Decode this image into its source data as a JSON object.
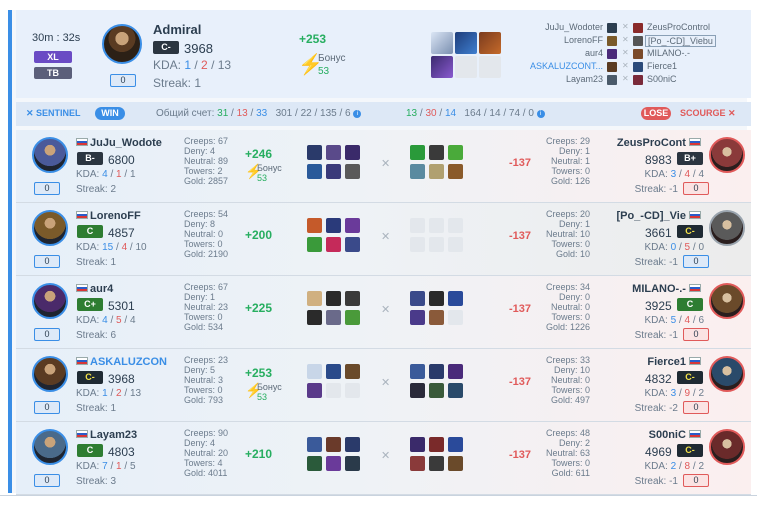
{
  "header": {
    "timer": "30m : 32s",
    "badge_xl": "XL",
    "badge_tb": "TB",
    "player_name": "Admiral",
    "rank": "C-",
    "rating": "3968",
    "kda_label": "KDA: ",
    "kills": "1",
    "deaths": "2",
    "assists": "13",
    "streak": "Streak: 1",
    "count": "0",
    "delta": "+253",
    "bonus_label": "Бонус",
    "bonus_value": "53"
  },
  "matchups": [
    {
      "left": "JuJu_Wodoter",
      "right": "ZeusProControl",
      "left_link": false,
      "boxed": false
    },
    {
      "left": "LorenoFF",
      "right": "[Po_-CD]_Viebu",
      "left_link": false,
      "boxed": true
    },
    {
      "left": "aur4",
      "right": "MILANO-.-",
      "left_link": false,
      "boxed": false
    },
    {
      "left": "ASKALUZCONT...",
      "right": "Fierce1",
      "left_link": true,
      "boxed": false
    },
    {
      "left": "Layam23",
      "right": "S00niC",
      "left_link": false,
      "boxed": false
    }
  ],
  "teambar": {
    "sentinel": "SENTINEL",
    "win": "WIN",
    "score_prefix": "Общий счет: ",
    "left_kills": "31",
    "left_deaths": "13",
    "left_assists": "33",
    "left_creeps": "301 / 22 / 135 / 6",
    "right_kills": "13",
    "right_deaths": "30",
    "right_assists": "14",
    "right_creeps": "164 / 14 / 74 / 0",
    "lose": "LOSE",
    "scourge": "SCOURGE",
    "info": "i"
  },
  "rows": [
    {
      "left": {
        "name": "JuJu_Wodote",
        "rank": "B-",
        "rating": "6800",
        "k": "4",
        "d": "1",
        "a": "1",
        "streak": "Streak: 2",
        "count": "0",
        "creeps": "Creeps: 67",
        "denies": "Deny: 4",
        "neutral": "Neutral: 89",
        "towers": "Towers: 2",
        "gold": "Gold: 2857",
        "link": false
      },
      "delta": "+246",
      "bonus": true,
      "bonus_label": "Бонус",
      "bonus_value": "53",
      "right_delta": "-137",
      "right": {
        "name": "ZeusProCont",
        "rank": "B+",
        "rating": "8983",
        "k": "3",
        "d": "4",
        "a": "4",
        "streak": "Streak: -1",
        "count": "0",
        "creeps": "Creeps: 29",
        "denies": "Deny: 1",
        "neutral": "Neutral: 1",
        "towers": "Towers: 0",
        "gold": "Gold: 126"
      }
    },
    {
      "left": {
        "name": "LorenoFF",
        "rank": "C",
        "rating": "4857",
        "k": "15",
        "d": "4",
        "a": "10",
        "streak": "Streak: 1",
        "count": "0",
        "creeps": "Creeps: 54",
        "denies": "Deny: 8",
        "neutral": "Neutral: 0",
        "towers": "Towers: 0",
        "gold": "Gold: 2190",
        "link": false
      },
      "delta": "+200",
      "bonus": false,
      "bonus_label": "",
      "bonus_value": "",
      "right_delta": "-137",
      "right": {
        "name": "[Po_-CD]_Vie",
        "rank": "C-",
        "rating": "3661",
        "k": "0",
        "d": "5",
        "a": "0",
        "streak": "Streak: -1",
        "count": "0",
        "creeps": "Creeps: 20",
        "denies": "Deny: 1",
        "neutral": "Neutral: 10",
        "towers": "Towers: 0",
        "gold": "Gold: 10"
      }
    },
    {
      "left": {
        "name": "aur4",
        "rank": "C+",
        "rating": "5301",
        "k": "4",
        "d": "5",
        "a": "4",
        "streak": "Streak: 6",
        "count": "0",
        "creeps": "Creeps: 67",
        "denies": "Deny: 1",
        "neutral": "Neutral: 23",
        "towers": "Towers: 0",
        "gold": "Gold: 534",
        "link": false
      },
      "delta": "+225",
      "bonus": false,
      "bonus_label": "",
      "bonus_value": "",
      "right_delta": "-137",
      "right": {
        "name": "MILANO-.-",
        "rank": "C",
        "rating": "3925",
        "k": "5",
        "d": "4",
        "a": "6",
        "streak": "Streak: -1",
        "count": "0",
        "creeps": "Creeps: 34",
        "denies": "Deny: 0",
        "neutral": "Neutral: 0",
        "towers": "Towers: 0",
        "gold": "Gold: 1226"
      }
    },
    {
      "left": {
        "name": "ASKALUZCON",
        "rank": "C-",
        "rating": "3968",
        "k": "1",
        "d": "2",
        "a": "13",
        "streak": "Streak: 1",
        "count": "0",
        "creeps": "Creeps: 23",
        "denies": "Deny: 5",
        "neutral": "Neutral: 3",
        "towers": "Towers: 0",
        "gold": "Gold: 793",
        "link": true
      },
      "delta": "+253",
      "bonus": true,
      "bonus_label": "Бонус",
      "bonus_value": "53",
      "right_delta": "-137",
      "right": {
        "name": "Fierce1",
        "rank": "C-",
        "rating": "4832",
        "k": "3",
        "d": "9",
        "a": "2",
        "streak": "Streak: -2",
        "count": "0",
        "creeps": "Creeps: 33",
        "denies": "Deny: 10",
        "neutral": "Neutral: 0",
        "towers": "Towers: 0",
        "gold": "Gold: 497"
      }
    },
    {
      "left": {
        "name": "Layam23",
        "rank": "C",
        "rating": "4803",
        "k": "7",
        "d": "1",
        "a": "5",
        "streak": "Streak: 3",
        "count": "0",
        "creeps": "Creeps: 90",
        "denies": "Deny: 4",
        "neutral": "Neutral: 20",
        "towers": "Towers: 4",
        "gold": "Gold: 4011",
        "link": false
      },
      "delta": "+210",
      "bonus": false,
      "bonus_label": "",
      "bonus_value": "",
      "right_delta": "-137",
      "right": {
        "name": "S00niC",
        "rank": "C-",
        "rating": "4969",
        "k": "2",
        "d": "8",
        "a": "2",
        "streak": "Streak: -1",
        "count": "0",
        "creeps": "Creeps: 48",
        "denies": "Deny: 2",
        "neutral": "Neutral: 63",
        "towers": "Towers: 0",
        "gold": "Gold: 611"
      }
    }
  ],
  "colors": {
    "accent": "#3a8ee6",
    "positive": "#27ae60",
    "negative": "#e05a5a",
    "bonus": "#f5b400"
  },
  "icons": [
    "vs-cross-icon",
    "bolt-icon",
    "info-icon",
    "flag-icon",
    "hero-portrait"
  ]
}
